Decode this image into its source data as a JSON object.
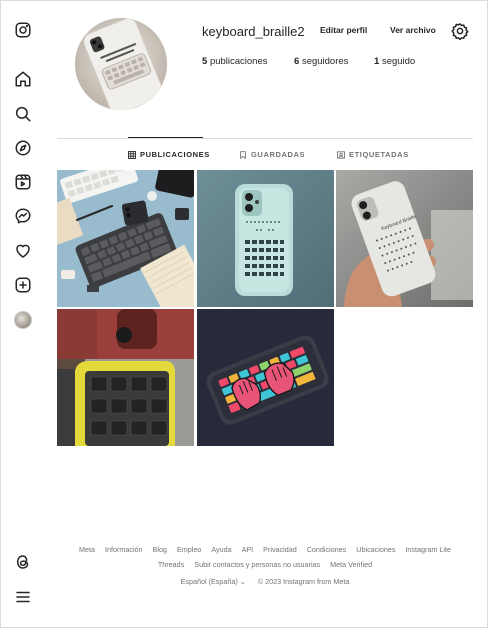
{
  "profile": {
    "username": "keyboard_braille2",
    "edit_profile_label": "Editar perfil",
    "archive_label": "Ver archivo",
    "stats": {
      "posts_count": "5",
      "posts_label": "publicaciones",
      "followers_count": "6",
      "followers_label": "seguidores",
      "following_count": "1",
      "following_label": "seguido"
    }
  },
  "tabs": [
    {
      "label": "PUBLICACIONES",
      "icon": "grid-icon",
      "active": true
    },
    {
      "label": "GUARDADAS",
      "icon": "bookmark-icon",
      "active": false
    },
    {
      "label": "ETIQUETADAS",
      "icon": "tagged-icon",
      "active": false
    }
  ],
  "sidebar": {
    "items": [
      "instagram-logo-icon",
      "home-icon",
      "search-icon",
      "explore-icon",
      "reels-icon",
      "messenger-icon",
      "heart-icon",
      "create-icon",
      "profile-avatar",
      "threads-icon",
      "menu-icon"
    ]
  },
  "posts": [
    {
      "subject": "braille keyboard on desk"
    },
    {
      "subject": "white phone case with braille keys"
    },
    {
      "subject": "hand holding braille phone"
    },
    {
      "subject": "yellow keypad closeup"
    },
    {
      "subject": "colorful keyboard phone case"
    }
  ],
  "footer": {
    "links": [
      "Meta",
      "Información",
      "Blog",
      "Empleo",
      "Ayuda",
      "API",
      "Privacidad",
      "Condiciones",
      "Ubicaciones",
      "Instagram Lite",
      "Threads",
      "Subir contactos y personas no usuarias",
      "Meta Verified"
    ],
    "language": "Español (España)",
    "copyright": "© 2023 Instagram from Meta"
  },
  "colors": {
    "text": "#262626",
    "muted": "#737373",
    "border": "#dbdbdb"
  }
}
